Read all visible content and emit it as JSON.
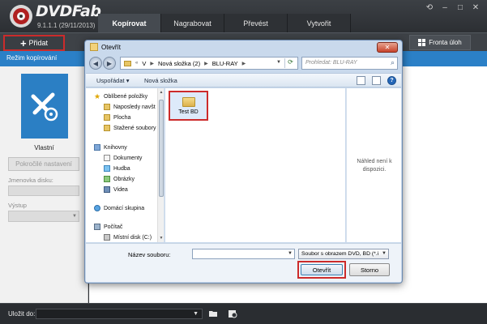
{
  "app": {
    "brand": "DVDFab",
    "version": "9.1.1.1 (29/11/2013)",
    "tabs": [
      {
        "label": "Kopírovat",
        "active": true
      },
      {
        "label": "Nagrabovat",
        "active": false
      },
      {
        "label": "Převést",
        "active": false
      },
      {
        "label": "Vytvořit",
        "active": false
      }
    ],
    "window_controls": [
      "restore",
      "minimize",
      "maximize",
      "close"
    ]
  },
  "toolbar": {
    "add_label": "Přidat",
    "queue_label": "Fronta úloh"
  },
  "mode_bar": {
    "label": "Režim kopírování"
  },
  "left_panel": {
    "mode_caption": "Vlastní",
    "advanced_button": "Pokročilé nastavení",
    "volume_label": "Jmenovka disku:",
    "volume_value": "",
    "output_label": "Výstup",
    "output_value": ""
  },
  "statusbar": {
    "save_to_label": "Uložit do:",
    "save_to_value": ""
  },
  "dialog": {
    "title": "Otevřít",
    "breadcrumb": [
      "V",
      "Nová složka (2)",
      "BLU-RAY"
    ],
    "search_placeholder": "Prohledat: BLU-RAY",
    "organize_label": "Uspořádat",
    "new_folder_label": "Nová složka",
    "nav_items": [
      {
        "label": "Oblíbené položky",
        "icon": "star-icon",
        "child": false
      },
      {
        "label": "Naposledy navšt",
        "icon": "folder-icon",
        "child": true
      },
      {
        "label": "Plocha",
        "icon": "folder-icon",
        "child": true
      },
      {
        "label": "Stažené soubory",
        "icon": "folder-icon",
        "child": true
      },
      {
        "label": "Knihovny",
        "icon": "library-icon",
        "child": false
      },
      {
        "label": "Dokumenty",
        "icon": "document-icon",
        "child": true
      },
      {
        "label": "Hudba",
        "icon": "music-icon",
        "child": true
      },
      {
        "label": "Obrázky",
        "icon": "picture-icon",
        "child": true
      },
      {
        "label": "Videa",
        "icon": "video-icon",
        "child": true
      },
      {
        "label": "Domácí skupina",
        "icon": "homegroup-icon",
        "child": false
      },
      {
        "label": "Počítač",
        "icon": "computer-icon",
        "child": false
      },
      {
        "label": "Místní disk (C:)",
        "icon": "disk-icon",
        "child": true
      }
    ],
    "file_items": [
      {
        "name": "Test BD",
        "icon": "folder-icon",
        "selected": true
      }
    ],
    "preview_text": "Náhled není k dispozici.",
    "filename_label": "Název souboru:",
    "filename_value": "",
    "filetype_value": "Soubor s obrazem DVD, BD (*.i",
    "open_button": "Otevřít",
    "cancel_button": "Storno"
  },
  "colors": {
    "accent_blue": "#2b80c7",
    "highlight_red": "#cc2b2b",
    "header_dark": "#2f3236"
  }
}
